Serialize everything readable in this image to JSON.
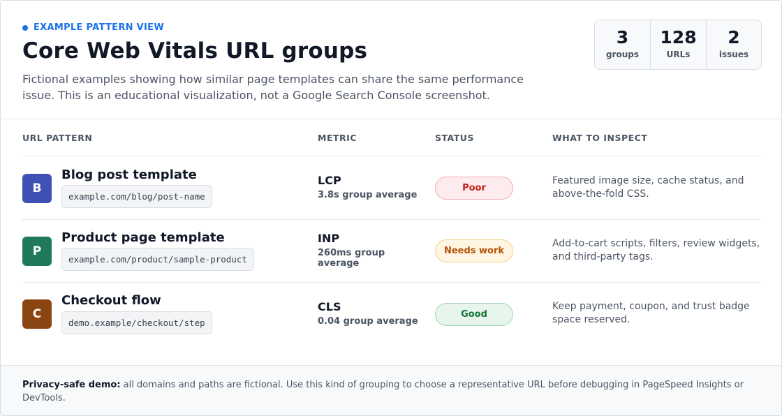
{
  "header": {
    "eyebrow": "EXAMPLE PATTERN VIEW",
    "title": "Core Web Vitals URL groups",
    "subtitle": "Fictional examples showing how similar page templates can share the same performance issue. This is an educational visualization, not a Google Search Console screenshot."
  },
  "stats": [
    {
      "value": "3",
      "label": "groups"
    },
    {
      "value": "128",
      "label": "URLs"
    },
    {
      "value": "2",
      "label": "issues"
    }
  ],
  "table": {
    "columns": [
      "URL PATTERN",
      "METRIC",
      "STATUS",
      "WHAT TO INSPECT"
    ],
    "rows": [
      {
        "initial": "B",
        "color": "#3f51b5",
        "name": "Blog post template",
        "path": "example.com/blog/post-name",
        "metric": "LCP",
        "average": "3.8s group average",
        "status": "Poor",
        "inspect": "Featured image size, cache status, and above-the-fold CSS."
      },
      {
        "initial": "P",
        "color": "#1e7a5a",
        "name": "Product page template",
        "path": "example.com/product/sample-product",
        "metric": "INP",
        "average": "260ms group average",
        "status": "Needs work",
        "inspect": "Add-to-cart scripts, filters, review widgets, and third-party tags."
      },
      {
        "initial": "C",
        "color": "#8b4513",
        "name": "Checkout flow",
        "path": "demo.example/checkout/step",
        "metric": "CLS",
        "average": "0.04 group average",
        "status": "Good",
        "inspect": "Keep payment, coupon, and trust badge space reserved."
      }
    ]
  },
  "footer": {
    "lead": "Privacy-safe demo:",
    "text": " all domains and paths are fictional. Use this kind of grouping to choose a representative URL before debugging in PageSpeed Insights or DevTools."
  },
  "colors": {
    "accent": "#1a73e8",
    "poor": "#c5221f",
    "needs_work": "#b45309",
    "good": "#137333"
  }
}
